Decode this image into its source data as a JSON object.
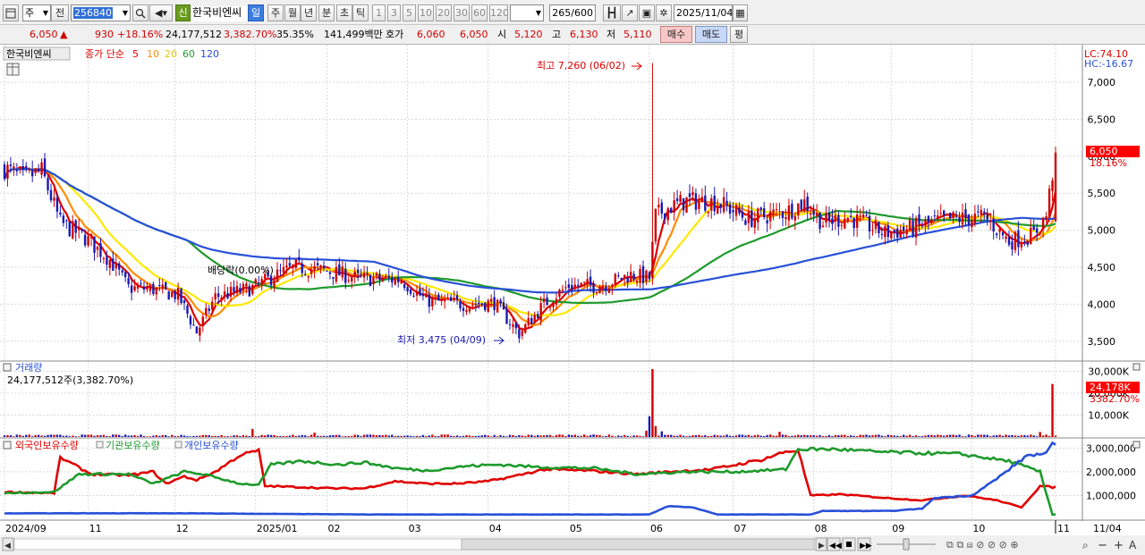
{
  "toolbar": {
    "market_type": "주",
    "prev_label": "전",
    "code": "256840",
    "new_badge": "신",
    "stock_name": "한국비엔씨",
    "periods": [
      "일",
      "주",
      "월",
      "년",
      "분",
      "초",
      "틱"
    ],
    "intervals": [
      "1",
      "3",
      "5",
      "10",
      "20",
      "30",
      "60",
      "120"
    ],
    "count": "265",
    "count_max": "/600",
    "date": "2025/11/04"
  },
  "quote": {
    "price": "6,050",
    "change": "930",
    "change_pct": "+18.16%",
    "volume": "24,177,512",
    "volume_ratio": "3,382.70%",
    "turnover_pct": "35.35%",
    "amount": "141,499백만",
    "bid_label": "호가",
    "ask": "6,060",
    "bid": "6,050",
    "open_label": "시",
    "open": "5,120",
    "high_label": "고",
    "high": "6,130",
    "low_label": "저",
    "low": "5,110",
    "buy_label": "매수",
    "sell_label": "매도",
    "eval_label": "평"
  },
  "price_panel": {
    "name_label": "한국비엔씨",
    "ma_label": "종가 단순",
    "ma_periods": [
      "5",
      "10",
      "20",
      "60",
      "120"
    ],
    "lc": "LC:74.10",
    "hc": "HC:-16.67",
    "high_annotation": "최고 7,260 (06/02)",
    "low_annotation": "최저 3,475 (04/09)",
    "dividend_annotation": "배당락(0.00%)",
    "current_price": "6,050",
    "current_pct": "18.16%"
  },
  "volume_panel": {
    "title": "거래량",
    "value_label": "24,177,512주(3,382.70%)",
    "current": "24,178K",
    "current_pct": "3382.70%"
  },
  "holdings_panel": {
    "series": [
      "외국인보유수량",
      "기관보유수량",
      "개인보유수량"
    ]
  },
  "nav": {
    "last_label": "11/04"
  },
  "colors": {
    "up": "#d00000",
    "down": "#1a1ab4",
    "ma5": "#e00000",
    "ma10": "#ff8c00",
    "ma20": "#ffe800",
    "ma60": "#1e9a2c",
    "ma120": "#2850d8",
    "foreign": "#e00000",
    "institution": "#1e9a2c",
    "individual": "#2850d8",
    "grid": "#d9d9d9",
    "badge": "#ff0000"
  },
  "chart_data": [
    {
      "type": "candlestick",
      "title": "한국비엔씨",
      "x_ticks": [
        "2024/09",
        "11",
        "12",
        "2025/01",
        "02",
        "03",
        "04",
        "05",
        "06",
        "07",
        "08",
        "09",
        "10",
        "11"
      ],
      "y_ticks": [
        3500,
        4000,
        4500,
        5000,
        5500,
        6000,
        6500,
        7000
      ],
      "ylim": [
        3280,
        7460
      ],
      "waypoints": [
        [
          0,
          5840
        ],
        [
          6,
          5700
        ],
        [
          12,
          5800
        ],
        [
          18,
          5100
        ],
        [
          26,
          4900
        ],
        [
          34,
          4600
        ],
        [
          40,
          4220
        ],
        [
          48,
          4200
        ],
        [
          56,
          4120
        ],
        [
          62,
          3620
        ],
        [
          68,
          4100
        ],
        [
          80,
          4220
        ],
        [
          88,
          4400
        ],
        [
          94,
          4500
        ],
        [
          104,
          4450
        ],
        [
          114,
          4350
        ],
        [
          128,
          4330
        ],
        [
          136,
          4050
        ],
        [
          148,
          4000
        ],
        [
          158,
          4020
        ],
        [
          166,
          3600
        ],
        [
          174,
          4000
        ],
        [
          182,
          4250
        ],
        [
          192,
          4250
        ],
        [
          202,
          4400
        ],
        [
          208,
          4350
        ],
        [
          210,
          5200
        ],
        [
          214,
          5300
        ],
        [
          220,
          5400
        ],
        [
          230,
          5380
        ],
        [
          240,
          5150
        ],
        [
          252,
          5250
        ],
        [
          258,
          5380
        ],
        [
          264,
          5100
        ],
        [
          272,
          5180
        ],
        [
          284,
          4960
        ],
        [
          292,
          5020
        ],
        [
          300,
          5120
        ],
        [
          306,
          5150
        ],
        [
          316,
          5180
        ],
        [
          324,
          4850
        ],
        [
          332,
          4940
        ],
        [
          336,
          5200
        ],
        [
          339,
          6050
        ]
      ],
      "events": [
        {
          "label": "최고",
          "value": 7260,
          "date": "06/02"
        },
        {
          "label": "최저",
          "value": 3475,
          "date": "04/09"
        },
        {
          "label": "배당락",
          "value_pct": "0.00%"
        }
      ],
      "moving_averages": [
        "5",
        "10",
        "20",
        "60",
        "120"
      ]
    },
    {
      "type": "bar",
      "title": "거래량",
      "y_ticks": [
        10000,
        20000,
        30000
      ],
      "unit": "K",
      "ylim": [
        0,
        33000
      ],
      "last": 24178,
      "spikes": [
        {
          "day": 80,
          "value": 3700
        },
        {
          "day": 100,
          "value": 2000
        },
        {
          "day": 207,
          "value": 2900
        },
        {
          "day": 208,
          "value": 9500
        },
        {
          "day": 209,
          "value": 31000
        },
        {
          "day": 210,
          "value": 5000
        },
        {
          "day": 212,
          "value": 2600
        },
        {
          "day": 250,
          "value": 2400
        },
        {
          "day": 334,
          "value": 2300
        },
        {
          "day": 338,
          "value": 24178
        }
      ]
    },
    {
      "type": "line",
      "series": [
        {
          "name": "외국인보유수량",
          "waypoints": [
            [
              0,
              1150000
            ],
            [
              16,
              1100000
            ],
            [
              18,
              2600000
            ],
            [
              28,
              1900000
            ],
            [
              40,
              1850000
            ],
            [
              48,
              2000000
            ],
            [
              52,
              1500000
            ],
            [
              58,
              1800000
            ],
            [
              62,
              1650000
            ],
            [
              68,
              2000000
            ],
            [
              76,
              2700000
            ],
            [
              82,
              2900000
            ],
            [
              84,
              1400000
            ],
            [
              96,
              1350000
            ],
            [
              106,
              1300000
            ],
            [
              116,
              1300000
            ],
            [
              126,
              1600000
            ],
            [
              136,
              1500000
            ],
            [
              146,
              1500000
            ],
            [
              156,
              1600000
            ],
            [
              164,
              1800000
            ],
            [
              174,
              2100000
            ],
            [
              188,
              2050000
            ],
            [
              204,
              1900000
            ],
            [
              214,
              2000000
            ],
            [
              228,
              2100000
            ],
            [
              236,
              2300000
            ],
            [
              244,
              2500000
            ],
            [
              252,
              2850000
            ],
            [
              256,
              2900000
            ],
            [
              260,
              1000000
            ],
            [
              270,
              1050000
            ],
            [
              284,
              900000
            ],
            [
              296,
              800000
            ],
            [
              310,
              1000000
            ],
            [
              320,
              800000
            ],
            [
              328,
              500000
            ],
            [
              334,
              1400000
            ],
            [
              338,
              1350000
            ]
          ]
        },
        {
          "name": "기관보유수량",
          "waypoints": [
            [
              0,
              1100000
            ],
            [
              16,
              1150000
            ],
            [
              24,
              1900000
            ],
            [
              40,
              1900000
            ],
            [
              48,
              1500000
            ],
            [
              58,
              2000000
            ],
            [
              64,
              1900000
            ],
            [
              76,
              1500000
            ],
            [
              82,
              1450000
            ],
            [
              86,
              2300000
            ],
            [
              96,
              2450000
            ],
            [
              108,
              2300000
            ],
            [
              116,
              2400000
            ],
            [
              126,
              2150000
            ],
            [
              136,
              2050000
            ],
            [
              150,
              2250000
            ],
            [
              160,
              2300000
            ],
            [
              172,
              2200000
            ],
            [
              190,
              2150000
            ],
            [
              204,
              1900000
            ],
            [
              220,
              2000000
            ],
            [
              236,
              2000000
            ],
            [
              252,
              2100000
            ],
            [
              256,
              2950000
            ],
            [
              268,
              2950000
            ],
            [
              280,
              2850000
            ],
            [
              292,
              2800000
            ],
            [
              308,
              2750000
            ],
            [
              324,
              2450000
            ],
            [
              334,
              2000000
            ],
            [
              338,
              200000
            ]
          ]
        },
        {
          "name": "개인보유수량",
          "waypoints": [
            [
              0,
              250000
            ],
            [
              60,
              250000
            ],
            [
              120,
              200000
            ],
            [
              200,
              200000
            ],
            [
              208,
              200000
            ],
            [
              214,
              550000
            ],
            [
              222,
              500000
            ],
            [
              230,
              200000
            ],
            [
              260,
              200000
            ],
            [
              264,
              350000
            ],
            [
              286,
              350000
            ],
            [
              296,
              450000
            ],
            [
              300,
              900000
            ],
            [
              312,
              1000000
            ],
            [
              320,
              1700000
            ],
            [
              330,
              2700000
            ],
            [
              336,
              2750000
            ],
            [
              338,
              3150000
            ]
          ]
        }
      ],
      "ylim": [
        0,
        3200000
      ],
      "y_ticks": [
        1000000,
        2000000,
        3000000
      ]
    }
  ]
}
